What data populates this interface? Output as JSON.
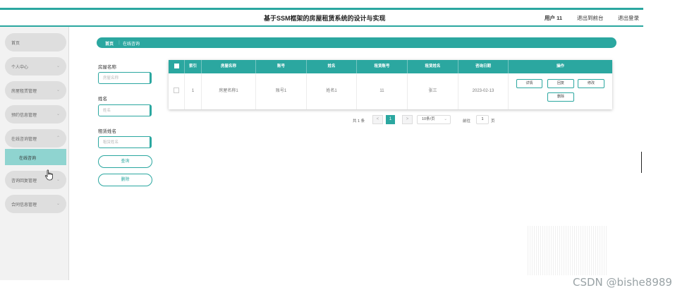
{
  "header": {
    "title": "基于SSM框架的房屋租赁系统的设计与实现",
    "user": "用户 11",
    "back_link": "退出到前台",
    "logout_link": "退出登录"
  },
  "sidebar": {
    "items": [
      {
        "label": "首页",
        "chevron": ""
      },
      {
        "label": "个人中心",
        "chevron": "⌄"
      },
      {
        "label": "房屋租赁管理",
        "chevron": "⌄"
      },
      {
        "label": "预约信息管理",
        "chevron": "⌄"
      },
      {
        "label": "在线咨询管理",
        "chevron": "⌃"
      },
      {
        "label": "咨询回复管理",
        "chevron": "⌄"
      },
      {
        "label": "合同信息管理",
        "chevron": "⌄"
      }
    ],
    "subitem": "在线咨询"
  },
  "breadcrumb": {
    "home": "首页",
    "separator": "⋮",
    "current": "在线咨询"
  },
  "filters": {
    "house_name_label": "房屋名称",
    "house_name_placeholder": "房屋名称",
    "name_label": "姓名",
    "name_placeholder": "姓名",
    "tenant_name_label": "租赁姓名",
    "tenant_name_placeholder": "租赁姓名",
    "query_button": "查询",
    "delete_button": "删除"
  },
  "table": {
    "columns": [
      "索引",
      "房屋名称",
      "账号",
      "姓名",
      "租赁账号",
      "租赁姓名",
      "咨询日期",
      "操作"
    ],
    "rows": [
      {
        "index": "1",
        "house_name": "房屋名称1",
        "account": "账号1",
        "name": "姓名1",
        "tenant_account": "11",
        "tenant_name": "张三",
        "date": "2023-02-13",
        "actions": [
          "详情",
          "回复",
          "修改",
          "删除"
        ]
      }
    ]
  },
  "pagination": {
    "total": "共 1 条",
    "prev": "<",
    "current": "1",
    "next": ">",
    "page_size": "10条/页",
    "goto_label": "前往",
    "goto_value": "1",
    "page_suffix": "页"
  },
  "watermark": "CSDN @bishe8989",
  "colors": {
    "accent": "#2ba7a0",
    "submenu_active": "#8fd4d0",
    "sidebar_bg": "#f2f2f2"
  }
}
